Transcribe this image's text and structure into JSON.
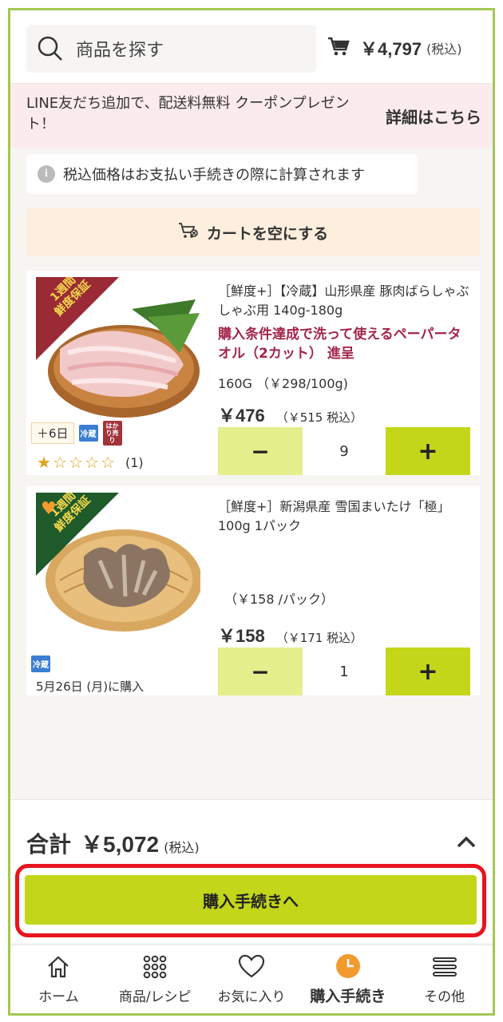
{
  "header": {
    "search_placeholder": "商品を探す",
    "cart_total": "￥4,797",
    "cart_tax_label": "(税込)"
  },
  "banner": {
    "message": "LINE友だち追加で、配送料無料 クーポンプレゼント！",
    "link": "詳細はこちら"
  },
  "tax_note": "税込価格はお支払い手続きの際に計算されます",
  "empty_cart_label": "カートを空にする",
  "items": [
    {
      "ribbon": [
        "1週間",
        "鮮度保証"
      ],
      "title": "［鮮度+］【冷蔵】山形県産 豚肉ばらしゃぶしゃぶ用 140g-180g",
      "promo": "購入条件達成で洗って使えるペーパータオル（2カット） 進呈",
      "weight": "160G （￥298/100g)",
      "price": "￥476",
      "price_tax": "（￥515 税込）",
      "quantity": "9",
      "tag_days": "＋6日",
      "tag_cold": "冷蔵",
      "tag_weigh": "はかり売り",
      "rating": 1,
      "rating_max": 5,
      "review_count": "(1)"
    },
    {
      "ribbon": [
        "1週間",
        "鮮度保証"
      ],
      "title": "［鮮度+］新潟県産 雪国まいたけ「極」100g 1パック",
      "unit_price": "（￥158 /パック）",
      "price": "￥158",
      "price_tax": "（￥171 税込）",
      "quantity": "1",
      "tag_cold": "冷蔵",
      "purchase_date": "5月26日 (月)に購入",
      "favorited": true
    }
  ],
  "footer": {
    "total_label": "合計",
    "total_value": "￥5,072",
    "total_tax": "(税込)",
    "checkout_label": "購入手続きへ"
  },
  "nav": [
    {
      "label": "ホーム",
      "icon": "home-icon"
    },
    {
      "label": "商品/レシピ",
      "icon": "grid-icon"
    },
    {
      "label": "お気に入り",
      "icon": "heart-icon"
    },
    {
      "label": "購入手続き",
      "icon": "clock-icon",
      "active": true
    },
    {
      "label": "その他",
      "icon": "menu-icon"
    }
  ],
  "colors": {
    "accent": "#c3d61a",
    "accent_light": "#e5ef8c",
    "promo": "#a2264a",
    "highlight": "#e8141e",
    "frame": "#a3c850",
    "active_nav": "#f29a2e"
  }
}
